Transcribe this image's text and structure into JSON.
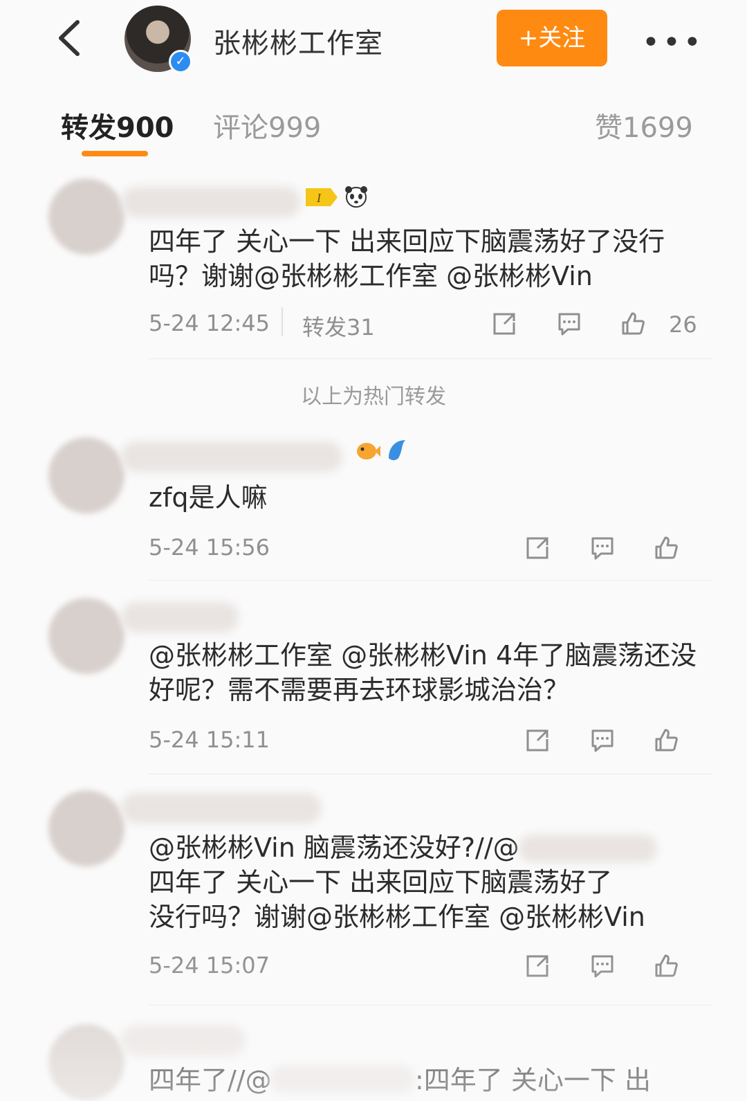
{
  "header": {
    "title": "张彬彬工作室",
    "follow_label": "+关注",
    "more_label": "•••",
    "verified_icon": "verified-check-icon"
  },
  "tabs": {
    "repost": "转发900",
    "comment": "评论999",
    "like": "赞1699"
  },
  "hot_label": "以上为热门转发",
  "posts": [
    {
      "text": "四年了 关心一下 出来回应下脑震荡好了没行吗？谢谢@张彬彬工作室 @张彬彬Vin",
      "time": "5-24 12:45",
      "repost_label": "转发31",
      "likes": "26"
    },
    {
      "text": "zfq是人嘛",
      "time": "5-24 15:56"
    },
    {
      "text": "@张彬彬工作室 @张彬彬Vin 4年了脑震荡还没好呢？需不需要再去环球影城治治？",
      "time": "5-24 15:11"
    },
    {
      "text": "@张彬彬Vin 脑震荡还没好?//@",
      "text2": "四年了 关心一下 出来回应下脑震荡好了",
      "text3": "没行吗？谢谢@张彬彬工作室 @张彬彬Vin",
      "time": "5-24 15:07"
    },
    {
      "text": "四年了//@",
      "text2": ":四年了 关心一下 出"
    }
  ],
  "colors": {
    "accent": "#ff8a12",
    "verified": "#2d8cf0"
  }
}
